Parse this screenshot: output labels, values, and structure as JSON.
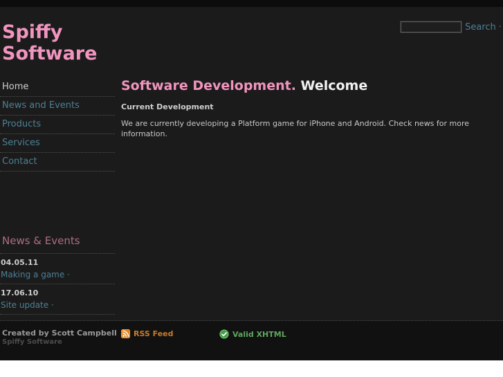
{
  "colors": {
    "background_main": "#1b1b1b",
    "background_footer": "#111111",
    "background_topbar": "#0c0c0c",
    "accent_pink": "#f195bf",
    "link_teal": "#4d8094",
    "news_rose": "#ad6e82",
    "rss_orange": "#c87b2b",
    "valid_green": "#5fa75f"
  },
  "header": {
    "logo_line1": "Spiffy",
    "logo_line2": "Software",
    "search_value": "",
    "search_label": "Search ·"
  },
  "nav": {
    "items": [
      {
        "label": "Home",
        "active": true
      },
      {
        "label": "News and Events",
        "active": false
      },
      {
        "label": "Products",
        "active": false
      },
      {
        "label": "Services",
        "active": false
      },
      {
        "label": "Contact",
        "active": false
      }
    ]
  },
  "news": {
    "title": "News & Events",
    "items": [
      {
        "date": "04.05.11",
        "link": "Making a game ·"
      },
      {
        "date": "17.06.10",
        "link": "Site update ·"
      }
    ]
  },
  "main": {
    "title_accent": "Software Development.",
    "title_rest": " Welcome",
    "subheading": "Current Development",
    "paragraph": "We are currently developing a Platform game for iPhone and Android. Check news for more information."
  },
  "footer": {
    "created_by": "Created by Scott Campbell",
    "site_name": "Spiffy Software",
    "rss_label": "RSS Feed",
    "valid_label": "Valid XHTML"
  }
}
